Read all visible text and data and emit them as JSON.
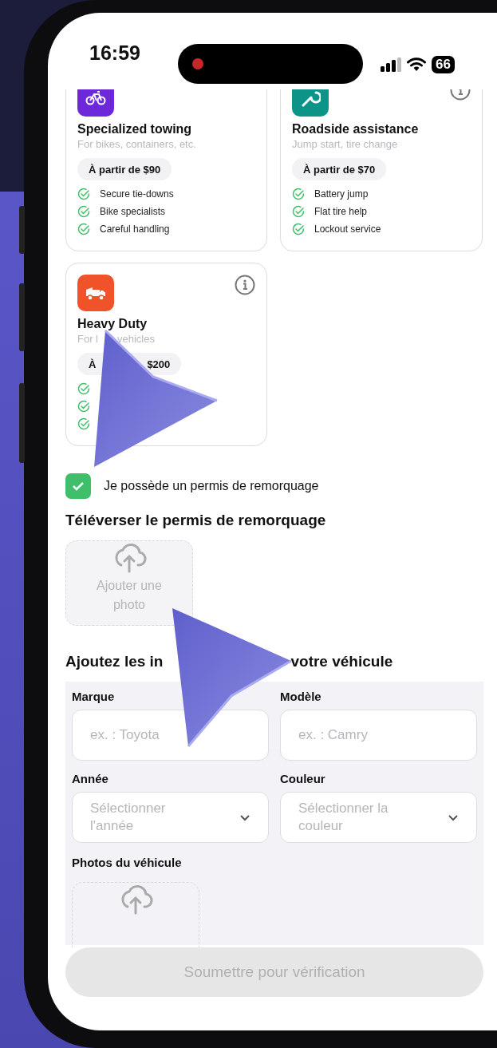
{
  "status_bar": {
    "time": "16:59",
    "battery": "66",
    "recording": true
  },
  "service_cards": [
    {
      "kind": "bike",
      "color": "#6d28d9",
      "info": false,
      "title": "Specialized towing",
      "subtitle": [
        "For bikes, containers, etc."
      ],
      "price": [
        "À partir de $90"
      ],
      "features": [
        {
          "text": "Secure tie-downs",
          "checked": true
        },
        {
          "text": "Bike specialists",
          "checked": true
        },
        {
          "text": "Careful handling",
          "checked": true
        }
      ]
    },
    {
      "kind": "wrench",
      "color": "#0d9488",
      "info": true,
      "title": "Roadside assistance",
      "subtitle": [
        "Jump start, tire change"
      ],
      "price": [
        "À partir de $70"
      ],
      "features": [
        {
          "text": "Battery jump",
          "checked": true
        },
        {
          "text": "Flat tire help",
          "checked": true
        },
        {
          "text": "Lockout service",
          "checked": true
        }
      ]
    },
    {
      "kind": "truck",
      "color": "#f0532a",
      "info": true,
      "title": "Heavy Duty",
      "subtitle": [
        "For l",
        "vehicles"
      ],
      "price": [
        "À",
        "$200"
      ],
      "features": [
        {
          "checked": true
        },
        {
          "checked": true
        },
        {
          "checked": true
        }
      ]
    }
  ],
  "license_checkbox": {
    "label": "Je possède un permis de remorquage",
    "checked": true
  },
  "license_upload": {
    "title": "Téléverser le permis de remorquage",
    "label": "Ajouter une photo"
  },
  "vehicle": {
    "title": [
      "Ajoutez les in",
      "votre véhicule"
    ],
    "fields": [
      {
        "kind": "text",
        "label": "Marque",
        "placeholder": "ex. : Toyota"
      },
      {
        "kind": "text",
        "label": "Modèle",
        "placeholder": "ex. : Camry"
      },
      {
        "kind": "select",
        "label": "Année",
        "placeholder": "Sélectionner l'année"
      },
      {
        "kind": "select",
        "label": "Couleur",
        "placeholder": "Sélectionner la couleur"
      }
    ],
    "photos_label": "Photos du véhicule"
  },
  "submit": {
    "label": "Soumettre pour vérification",
    "disabled": true
  }
}
